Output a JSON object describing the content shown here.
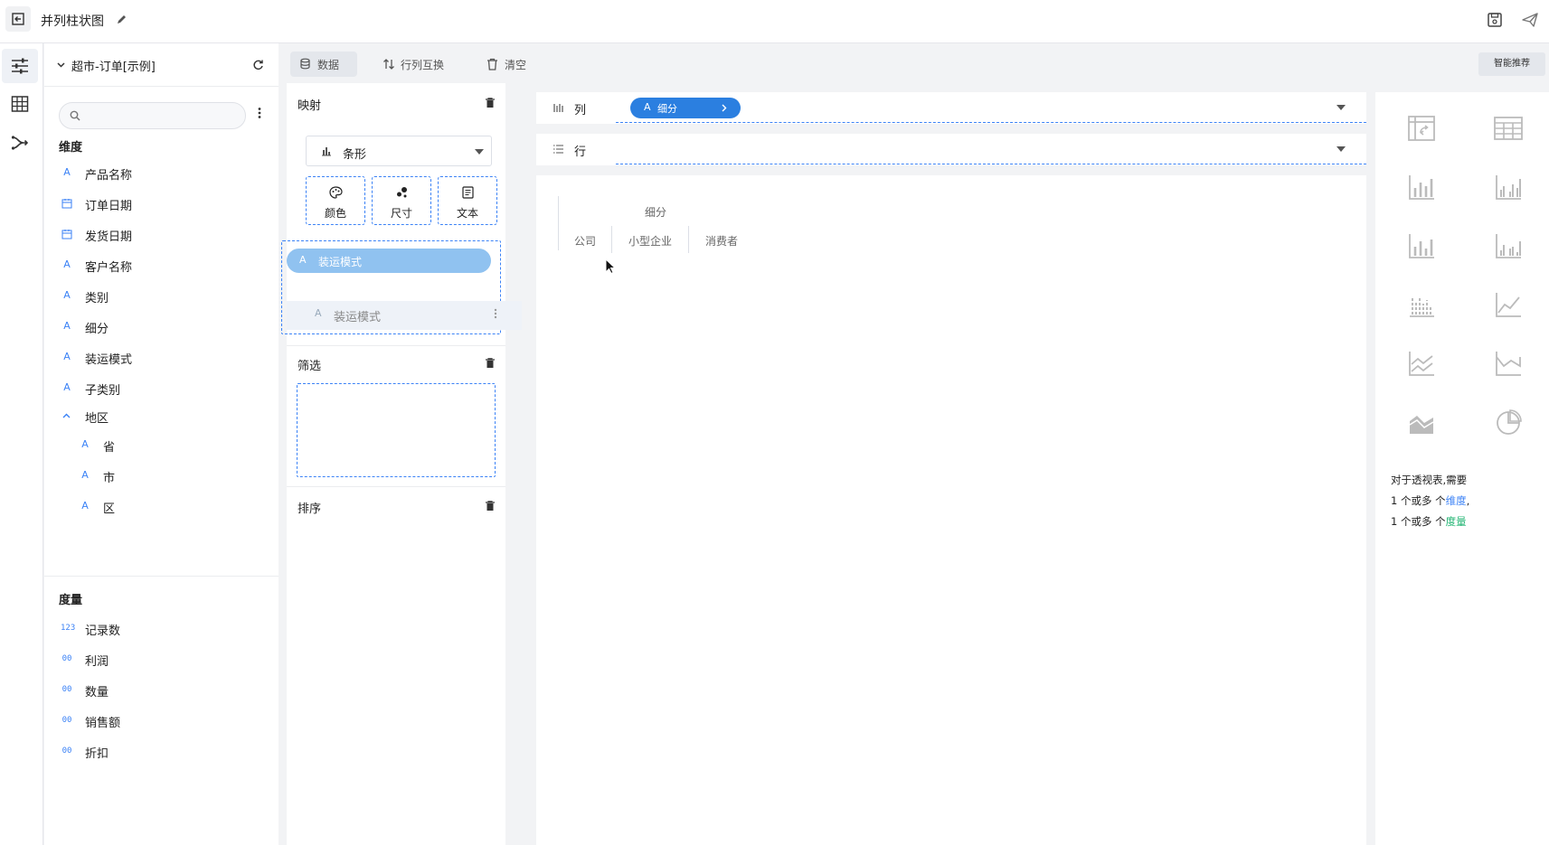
{
  "header": {
    "title": "并列柱状图"
  },
  "datasource": {
    "name": "超市-订单[示例]",
    "search_placeholder": ""
  },
  "dimensions": {
    "title": "维度",
    "items": [
      {
        "icon": "A",
        "label": "产品名称"
      },
      {
        "icon": "calendar",
        "label": "订单日期"
      },
      {
        "icon": "calendar",
        "label": "发货日期"
      },
      {
        "icon": "A",
        "label": "客户名称"
      },
      {
        "icon": "A",
        "label": "类别"
      },
      {
        "icon": "A",
        "label": "细分"
      },
      {
        "icon": "A",
        "label": "装运模式"
      },
      {
        "icon": "A",
        "label": "子类别"
      }
    ],
    "group": {
      "label": "地区",
      "children": [
        {
          "icon": "A",
          "label": "省"
        },
        {
          "icon": "A",
          "label": "市"
        },
        {
          "icon": "A",
          "label": "区"
        }
      ]
    }
  },
  "measures": {
    "title": "度量",
    "items": [
      {
        "icon": "123",
        "label": "记录数"
      },
      {
        "icon": "00",
        "label": "利润"
      },
      {
        "icon": "00",
        "label": "数量"
      },
      {
        "icon": "00",
        "label": "销售额"
      },
      {
        "icon": "00",
        "label": "折扣"
      }
    ]
  },
  "toolbar": {
    "data_label": "数据",
    "swap_label": "行列互换",
    "clear_label": "清空",
    "smart_label": "智能推荐"
  },
  "mapping": {
    "title": "映射",
    "chart_type": "条形",
    "encodings": [
      "颜色",
      "尺寸",
      "文本"
    ],
    "color_field": "装运模式",
    "dragging_field": "装运模式"
  },
  "filter": {
    "title": "筛选"
  },
  "sort": {
    "title": "排序"
  },
  "shelves": {
    "columns_label": "列",
    "columns_field": "细分",
    "rows_label": "行"
  },
  "pivot": {
    "header": "细分",
    "values": [
      "公司",
      "小型企业",
      "消费者"
    ]
  },
  "chart_list": {
    "hint_line1": "对于透视表,需要",
    "hint_line2_prefix": "1 个或多 个",
    "hint_line2_keyword": "维度",
    "hint_line2_suffix": ",",
    "hint_line3_prefix": "1 个或多 个",
    "hint_line3_keyword": "度量"
  },
  "colors": {
    "accent": "#3b82f6",
    "pill_dark": "#2b7fe0",
    "pill_light": "#90c2f0",
    "measure_keyword": "#22b573"
  }
}
